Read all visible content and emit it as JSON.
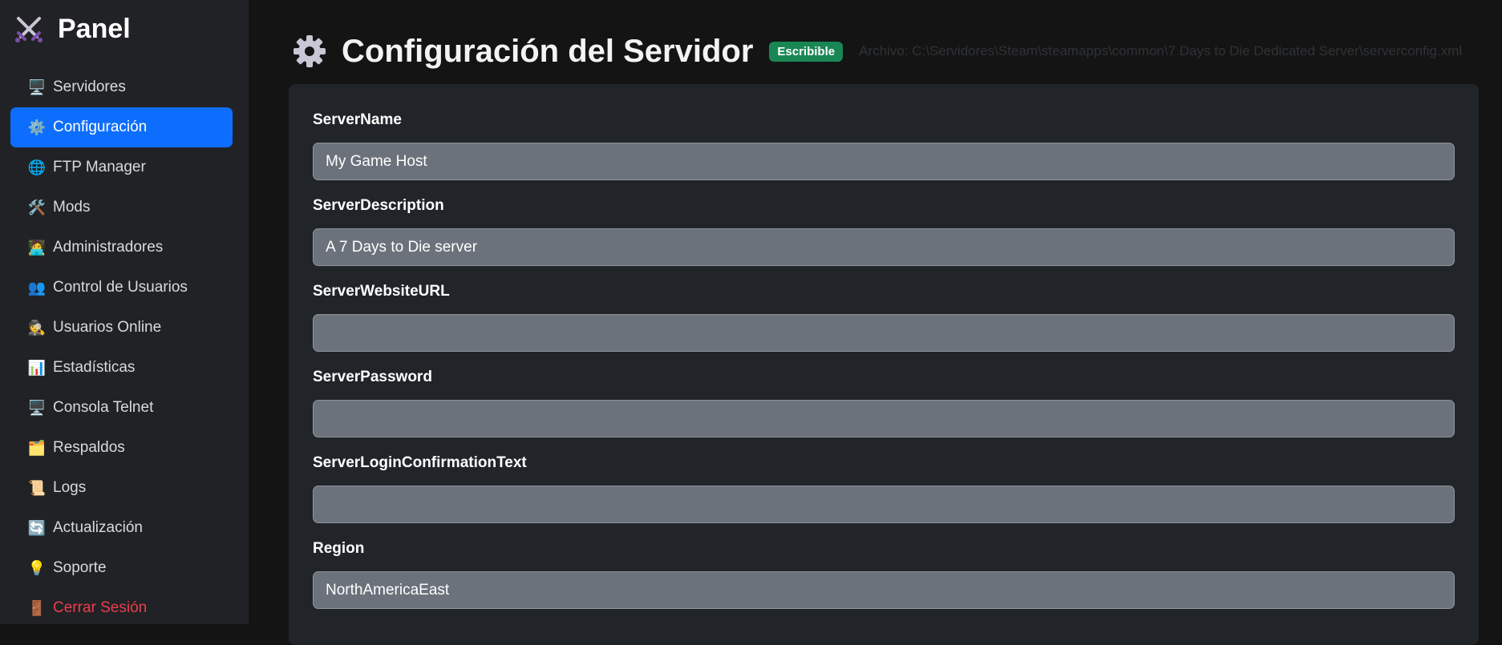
{
  "brand": {
    "title": "Panel",
    "icon": "crossed-swords-icon"
  },
  "sidebar": {
    "items": [
      {
        "label": "Servidores",
        "icon": "🖥️",
        "active": false
      },
      {
        "label": "Configuración",
        "icon": "⚙️",
        "active": true
      },
      {
        "label": "FTP Manager",
        "icon": "🌐",
        "active": false
      },
      {
        "label": "Mods",
        "icon": "🛠️",
        "active": false
      },
      {
        "label": "Administradores",
        "icon": "🧑‍💻",
        "active": false
      },
      {
        "label": "Control de Usuarios",
        "icon": "👥",
        "active": false
      },
      {
        "label": "Usuarios Online",
        "icon": "🕵️",
        "active": false
      },
      {
        "label": "Estadísticas",
        "icon": "📊",
        "active": false
      },
      {
        "label": "Consola Telnet",
        "icon": "🖥️",
        "active": false
      },
      {
        "label": "Respaldos",
        "icon": "🗂️",
        "active": false
      },
      {
        "label": "Logs",
        "icon": "📜",
        "active": false
      },
      {
        "label": "Actualización",
        "icon": "🔄",
        "active": false
      },
      {
        "label": "Soporte",
        "icon": "💡",
        "active": false
      },
      {
        "label": "Cerrar Sesión",
        "icon": "🚪",
        "active": false
      }
    ]
  },
  "header": {
    "title": "Configuración del Servidor",
    "icon": "gear-icon",
    "badge": "Escribible",
    "file_path": "Archivo: C:\\Servidores\\Steam\\steamapps\\common\\7 Days to Die Dedicated Server\\serverconfig.xml"
  },
  "form": {
    "fields": [
      {
        "label": "ServerName",
        "value": "My Game Host"
      },
      {
        "label": "ServerDescription",
        "value": "A 7 Days to Die server"
      },
      {
        "label": "ServerWebsiteURL",
        "value": ""
      },
      {
        "label": "ServerPassword",
        "value": ""
      },
      {
        "label": "ServerLoginConfirmationText",
        "value": ""
      },
      {
        "label": "Region",
        "value": "NorthAmericaEast"
      }
    ]
  },
  "colors": {
    "accent": "#0d6efd",
    "badge": "#198754",
    "logout": "#ea3e4d",
    "sidebar_bg": "#212225",
    "card_bg": "#212429",
    "input_bg": "#6c727b"
  }
}
